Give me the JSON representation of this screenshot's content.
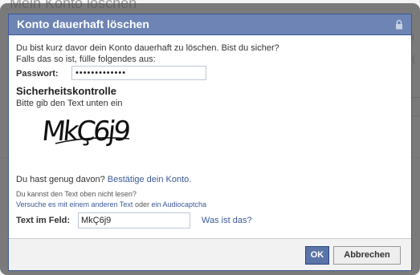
{
  "background": {
    "page_title": "Mein Konto löschen"
  },
  "dialog": {
    "title": "Konto dauerhaft löschen",
    "intro_line1": "Du bist kurz davor dein Konto dauerhaft zu löschen. Bist du sicher?",
    "intro_line2": "Falls das so ist, fülle folgendes aus:",
    "password_label": "Passwort:",
    "password_value": "•••••••••••••",
    "security_heading": "Sicherheitskontrolle",
    "security_instruction": "Bitte gib den Text unten ein",
    "captcha_text": "MkÇ6j9",
    "fed_up_text": "Du hast genug davon?",
    "confirm_account_link": "Bestätige dein Konto.",
    "cannot_read_text": "Du kannst den Text oben nicht lesen?",
    "try_other_text_link": "Versuche es mit einem anderen Text",
    "or_text": "oder",
    "audio_captcha_link": "ein Audiocaptcha",
    "text_field_label": "Text im Feld:",
    "text_field_value": "MkÇ6j9",
    "what_is_this_link": "Was ist das?",
    "ok_button": "OK",
    "cancel_button": "Abbrechen",
    "lock_icon": "lock-icon"
  },
  "colors": {
    "header": "#6d84b4",
    "border": "#3b5998",
    "link": "#3b5998",
    "ok_button": "#5b74a8"
  }
}
